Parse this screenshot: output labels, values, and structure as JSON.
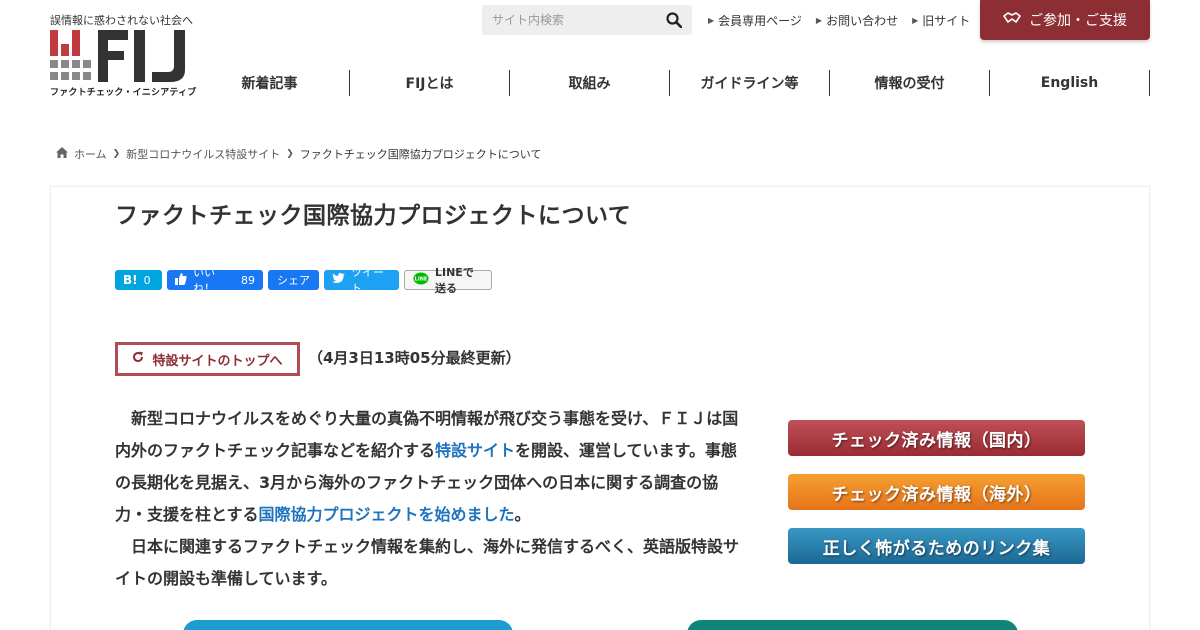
{
  "header": {
    "tagline": "誤情報に惑わされない社会へ",
    "logo_text": "FIJ",
    "logo_sub": "ファクトチェック・イニシアティブ",
    "search": {
      "placeholder": "サイト内検索"
    },
    "top_links": [
      {
        "label": "会員専用ページ"
      },
      {
        "label": "お問い合わせ"
      },
      {
        "label": "旧サイト"
      }
    ],
    "join_label": "ご参加・ご支援",
    "nav": [
      {
        "label": "新着記事"
      },
      {
        "label": "FIJとは"
      },
      {
        "label": "取組み"
      },
      {
        "label": "ガイドライン等"
      },
      {
        "label": "情報の受付"
      },
      {
        "label": "English"
      }
    ]
  },
  "breadcrumb": {
    "home": "ホーム",
    "parent": "新型コロナウイルス特設サイト",
    "current": "ファクトチェック国際協力プロジェクトについて"
  },
  "article": {
    "title": "ファクトチェック国際協力プロジェクトについて",
    "share": {
      "hatena_count": "0",
      "fb_like_label": "いいね！",
      "fb_like_count": "89",
      "fb_share_label": "シェア",
      "tweet_label": "ツイート",
      "line_label": "LINEで送る"
    },
    "top_link_label": "特設サイトのトップへ",
    "updated": "（4月3日13時05分最終更新）",
    "p1_a": "新型コロナウイルスをめぐり大量の真偽不明情報が飛び交う事態を受け、ＦＩＪは国内外のファクトチェック記事などを紹介する",
    "p1_link1": "特設サイト",
    "p1_b": "を開設、運営しています。事態の長期化を見据え、3月から海外のファクトチェック団体への日本に関する調査の協力・支援を柱とする",
    "p1_link2": "国際協力プロジェクトを始めました",
    "p1_c": "。",
    "p2": "日本に関連するファクトチェック情報を集約し、海外に発信するべく、英語版特設サイトの開設も準備しています。"
  },
  "sidebar": {
    "buttons": [
      {
        "label": "チェック済み情報（国内）"
      },
      {
        "label": "チェック済み情報（海外）"
      },
      {
        "label": "正しく怖がるためのリンク集"
      }
    ]
  },
  "colors": {
    "brand": "#8c2e34",
    "link": "#1e73be"
  }
}
